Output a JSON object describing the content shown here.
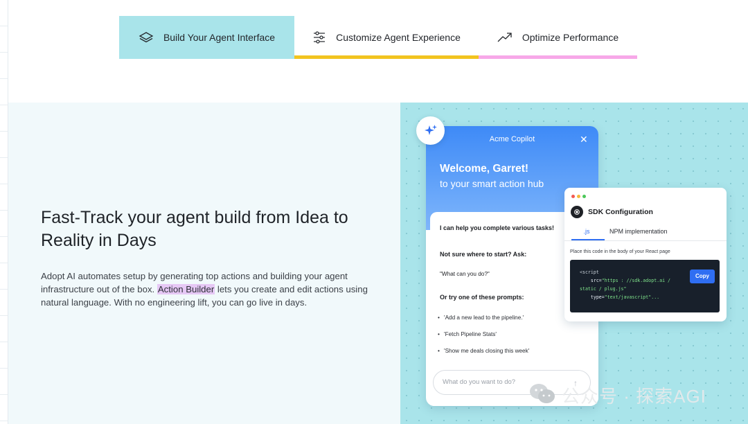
{
  "tabs": [
    {
      "label": "Build Your Agent Interface",
      "icon": "layers-icon",
      "active": true,
      "color": "#a9e4ea"
    },
    {
      "label": "Customize Agent Experience",
      "icon": "sliders-icon",
      "color": "#f2c41f"
    },
    {
      "label": "Optimize Performance",
      "icon": "trend-up-icon",
      "color": "#f7a8e8"
    }
  ],
  "hero": {
    "headline": "Fast-Track your agent build from Idea to Reality in Days",
    "body_before": "Adopt AI automates setup by generating top actions and building your agent infrastructure out of the box. ",
    "body_highlight": "Action Builder",
    "body_after": " lets you create and edit actions using natural language. With no engineering lift, you can go live in days."
  },
  "copilot": {
    "title": "Acme Copilot",
    "close": "✕",
    "welcome": "Welcome, Garret!",
    "welcome_sub": "to your smart action hub",
    "intro": "I can help you complete various tasks!",
    "ask_heading": "Not sure where to start? Ask:",
    "ask_example": "\"What can you do?\"",
    "prompts_heading": "Or try one of these prompts:",
    "prompts": [
      "'Add a new lead to the pipeline.'",
      "'Fetch Pipeline Stats'",
      "'Show me deals closing this week'"
    ],
    "input_placeholder": "What do you want to do?",
    "send": "↑"
  },
  "sdk": {
    "title": "SDK Configuration",
    "tab_js": ".js",
    "tab_npm": "NPM implementation",
    "note": "Place this code in the body of your React page",
    "code": {
      "l1": "<script",
      "l2_attr": "    src=",
      "l2_val": "\"https : //sdk.adopt.ai /",
      "l3_val": "static / plug.js\"",
      "l4_attr": "    type=",
      "l4_val": "\"text/javascript\"..."
    },
    "copy": "Copy"
  },
  "watermark": "公众号 · 探索AGI",
  "colors": {
    "accent": "#2f6ef2",
    "tab_active": "#a9e4ea",
    "highlight": "#e6c8f5"
  }
}
